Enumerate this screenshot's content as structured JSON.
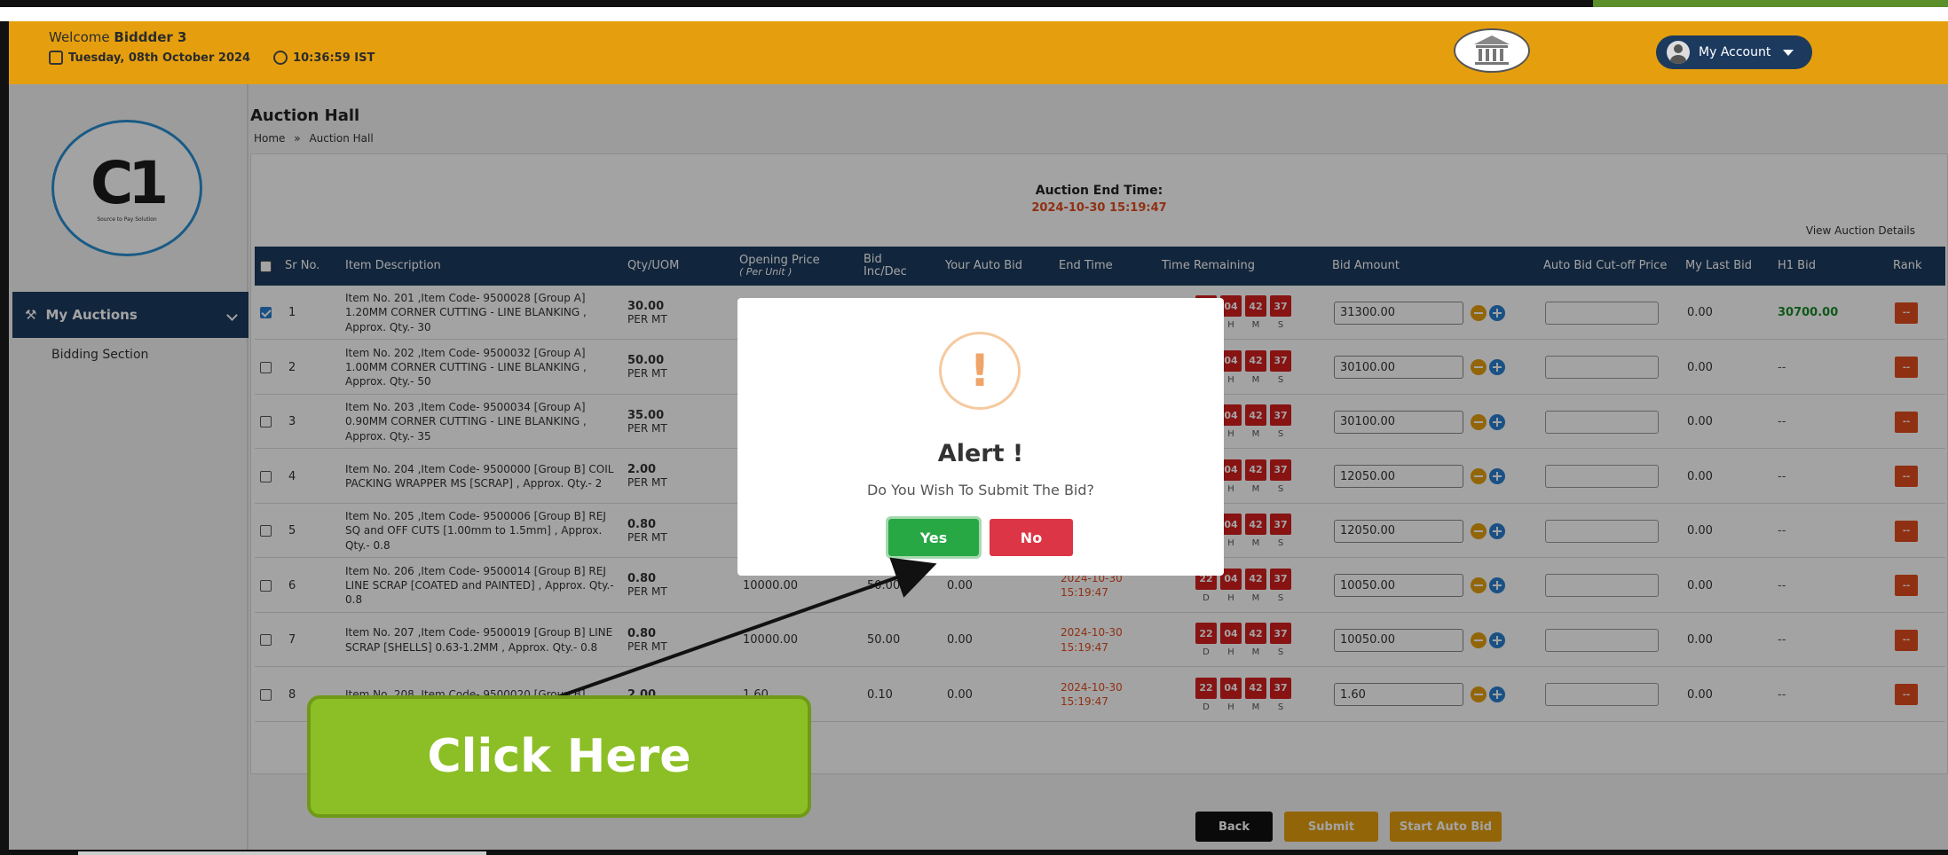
{
  "header": {
    "welcome_prefix": "Welcome",
    "user_name": "Biddder 3",
    "date": "Tuesday, 08th October 2024",
    "time": "10:36:59 IST",
    "account_label": "My Account"
  },
  "sidebar": {
    "logo_mark": "C1",
    "logo_tagline": "Source to Pay Solution",
    "active_item": "My Auctions",
    "sub_item": "Bidding Section"
  },
  "page": {
    "title": "Auction Hall",
    "breadcrumb_home": "Home",
    "breadcrumb_sep": "»",
    "breadcrumb_current": "Auction Hall",
    "end_time_label": "Auction End Time:",
    "end_time_value": "2024-10-30 15:19:47",
    "view_details": "View Auction Details"
  },
  "table": {
    "headers": {
      "sr": "Sr No.",
      "desc": "Item Description",
      "qty": "Qty/UOM",
      "opening": "Opening Price",
      "opening_sub": "( Per Unit )",
      "bid_inc": "Bid",
      "bid_inc2": "Inc/Dec",
      "auto_bid": "Your Auto Bid",
      "end_time": "End Time",
      "remaining": "Time Remaining",
      "bid_amount": "Bid Amount",
      "cutoff": "Auto Bid Cut-off Price",
      "last_bid": "My Last Bid",
      "h1": "H1 Bid",
      "rank": "Rank"
    },
    "timer_labels": [
      "D",
      "H",
      "M",
      "S"
    ],
    "rows": [
      {
        "sr": "1",
        "desc": "Item No. 201 ,Item Code- 9500028 [Group A] 1.20MM CORNER CUTTING - LINE BLANKING , Approx. Qty.- 30",
        "qty": "30.00",
        "uom": "PER MT",
        "opening": "",
        "inc": "",
        "auto": "",
        "end": "",
        "d": "",
        "h": "04",
        "m": "42",
        "s": "37",
        "bid": "31300.00",
        "last": "0.00",
        "h1": "30700.00",
        "rank": "--",
        "checked": true
      },
      {
        "sr": "2",
        "desc": "Item No. 202 ,Item Code- 9500032 [Group A] 1.00MM CORNER CUTTING - LINE BLANKING , Approx. Qty.- 50",
        "qty": "50.00",
        "uom": "PER MT",
        "opening": "",
        "inc": "",
        "auto": "",
        "end": "",
        "d": "",
        "h": "04",
        "m": "42",
        "s": "37",
        "bid": "30100.00",
        "last": "0.00",
        "h1": "--",
        "rank": "--",
        "checked": false
      },
      {
        "sr": "3",
        "desc": "Item No. 203 ,Item Code- 9500034 [Group A] 0.90MM CORNER CUTTING - LINE BLANKING , Approx. Qty.- 35",
        "qty": "35.00",
        "uom": "PER MT",
        "opening": "",
        "inc": "",
        "auto": "",
        "end": "",
        "d": "",
        "h": "04",
        "m": "42",
        "s": "37",
        "bid": "30100.00",
        "last": "0.00",
        "h1": "--",
        "rank": "--",
        "checked": false
      },
      {
        "sr": "4",
        "desc": "Item No. 204 ,Item Code- 9500000 [Group B] COIL PACKING WRAPPER MS [SCRAP] , Approx. Qty.- 2",
        "qty": "2.00",
        "uom": "PER MT",
        "opening": "",
        "inc": "",
        "auto": "",
        "end": "",
        "d": "",
        "h": "04",
        "m": "42",
        "s": "37",
        "bid": "12050.00",
        "last": "0.00",
        "h1": "--",
        "rank": "--",
        "checked": false
      },
      {
        "sr": "5",
        "desc": "Item No. 205 ,Item Code- 9500006 [Group B] REJ SQ and OFF CUTS [1.00mm to 1.5mm] , Approx. Qty.- 0.8",
        "qty": "0.80",
        "uom": "PER MT",
        "opening": "",
        "inc": "",
        "auto": "",
        "end": "",
        "d": "",
        "h": "04",
        "m": "42",
        "s": "37",
        "bid": "12050.00",
        "last": "0.00",
        "h1": "--",
        "rank": "--",
        "checked": false
      },
      {
        "sr": "6",
        "desc": "Item No. 206 ,Item Code- 9500014 [Group B] REJ LINE SCRAP [COATED and PAINTED] , Approx. Qty.- 0.8",
        "qty": "0.80",
        "uom": "PER MT",
        "opening": "10000.00",
        "inc": "50.00",
        "auto": "0.00",
        "end": "2024-10-30 15:19:47",
        "d": "22",
        "h": "04",
        "m": "42",
        "s": "37",
        "bid": "10050.00",
        "last": "0.00",
        "h1": "--",
        "rank": "--",
        "checked": false
      },
      {
        "sr": "7",
        "desc": "Item No. 207 ,Item Code- 9500019 [Group B] LINE SCRAP [SHELLS] 0.63-1.2MM , Approx. Qty.- 0.8",
        "qty": "0.80",
        "uom": "PER MT",
        "opening": "10000.00",
        "inc": "50.00",
        "auto": "0.00",
        "end": "2024-10-30 15:19:47",
        "d": "22",
        "h": "04",
        "m": "42",
        "s": "37",
        "bid": "10050.00",
        "last": "0.00",
        "h1": "--",
        "rank": "--",
        "checked": false
      },
      {
        "sr": "8",
        "desc": "Item No. 208 ,Item Code- 9500020 [Group B]",
        "qty": "2.00",
        "uom": "",
        "opening": "1.60",
        "inc": "0.10",
        "auto": "0.00",
        "end": "2024-10-30 15:19:47",
        "d": "22",
        "h": "04",
        "m": "42",
        "s": "37",
        "bid": "1.60",
        "last": "0.00",
        "h1": "--",
        "rank": "--",
        "checked": false
      }
    ]
  },
  "actions": {
    "back": "Back",
    "submit": "Submit",
    "auto_bid": "Start Auto Bid"
  },
  "modal": {
    "icon": "!",
    "title": "Alert !",
    "message": "Do You Wish To Submit The Bid?",
    "yes": "Yes",
    "no": "No"
  },
  "callout": {
    "text": "Click Here"
  },
  "colors": {
    "header": "#e59f0e",
    "navy": "#1c3a5e",
    "danger": "#dc3545",
    "success": "#28a745",
    "callout": "#8cbf25"
  }
}
